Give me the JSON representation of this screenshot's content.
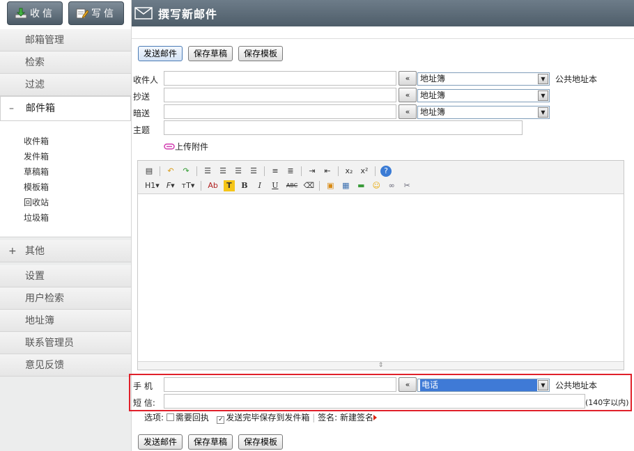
{
  "topbar": {
    "inbox_label": "收信",
    "compose_label": "写信"
  },
  "sidebar": {
    "mailbox_mgmt": "邮箱管理",
    "search": "检索",
    "filter": "过滤",
    "mailbox": {
      "sign": "–",
      "label": "邮件箱"
    },
    "folders": [
      "收件箱",
      "发件箱",
      "草稿箱",
      "模板箱",
      "回收站",
      "垃圾箱"
    ],
    "other": {
      "sign": "+",
      "label": "其他"
    },
    "items": [
      "设置",
      "用户检索",
      "地址簿",
      "联系管理员",
      "意见反馈"
    ]
  },
  "header": {
    "title": "撰写新邮件"
  },
  "actions": {
    "send": "发送邮件",
    "save_draft": "保存草稿",
    "save_template": "保存模板"
  },
  "form": {
    "to_label": "收件人",
    "cc_label": "抄送",
    "bcc_label": "暗送",
    "subject_label": "主题",
    "arrow_btn": "«",
    "addressbook": "地址簿",
    "public_addressbook": "公共地址本",
    "attach_label": "上传附件"
  },
  "toolbar": {
    "row1": [
      "source",
      "undo",
      "redo",
      "align-left",
      "align-center",
      "align-right",
      "align-justify",
      "ordered-list",
      "unordered-list",
      "indent",
      "outdent",
      "subscript",
      "superscript",
      "help"
    ],
    "row2_text": {
      "heading": "H1",
      "font": "F",
      "size": "тT",
      "color": "Ab",
      "bg": "T",
      "bold": "B",
      "italic": "I",
      "underline": "U",
      "strike": "ABC"
    }
  },
  "sms": {
    "mobile_label": "手 机",
    "sms_label": "短 信:",
    "phone_option": "电话",
    "public_addressbook": "公共地址本",
    "limit": "(140字以内)"
  },
  "options": {
    "label": "选项:",
    "receipt": "需要回执",
    "save_sent": "发送完毕保存到发件箱",
    "signature_label": "签名:",
    "signature_link": "新建签名"
  },
  "colors": {
    "header": "#5a6875",
    "accent_red": "#e0202a",
    "select_highlight": "#3f7ad6"
  }
}
